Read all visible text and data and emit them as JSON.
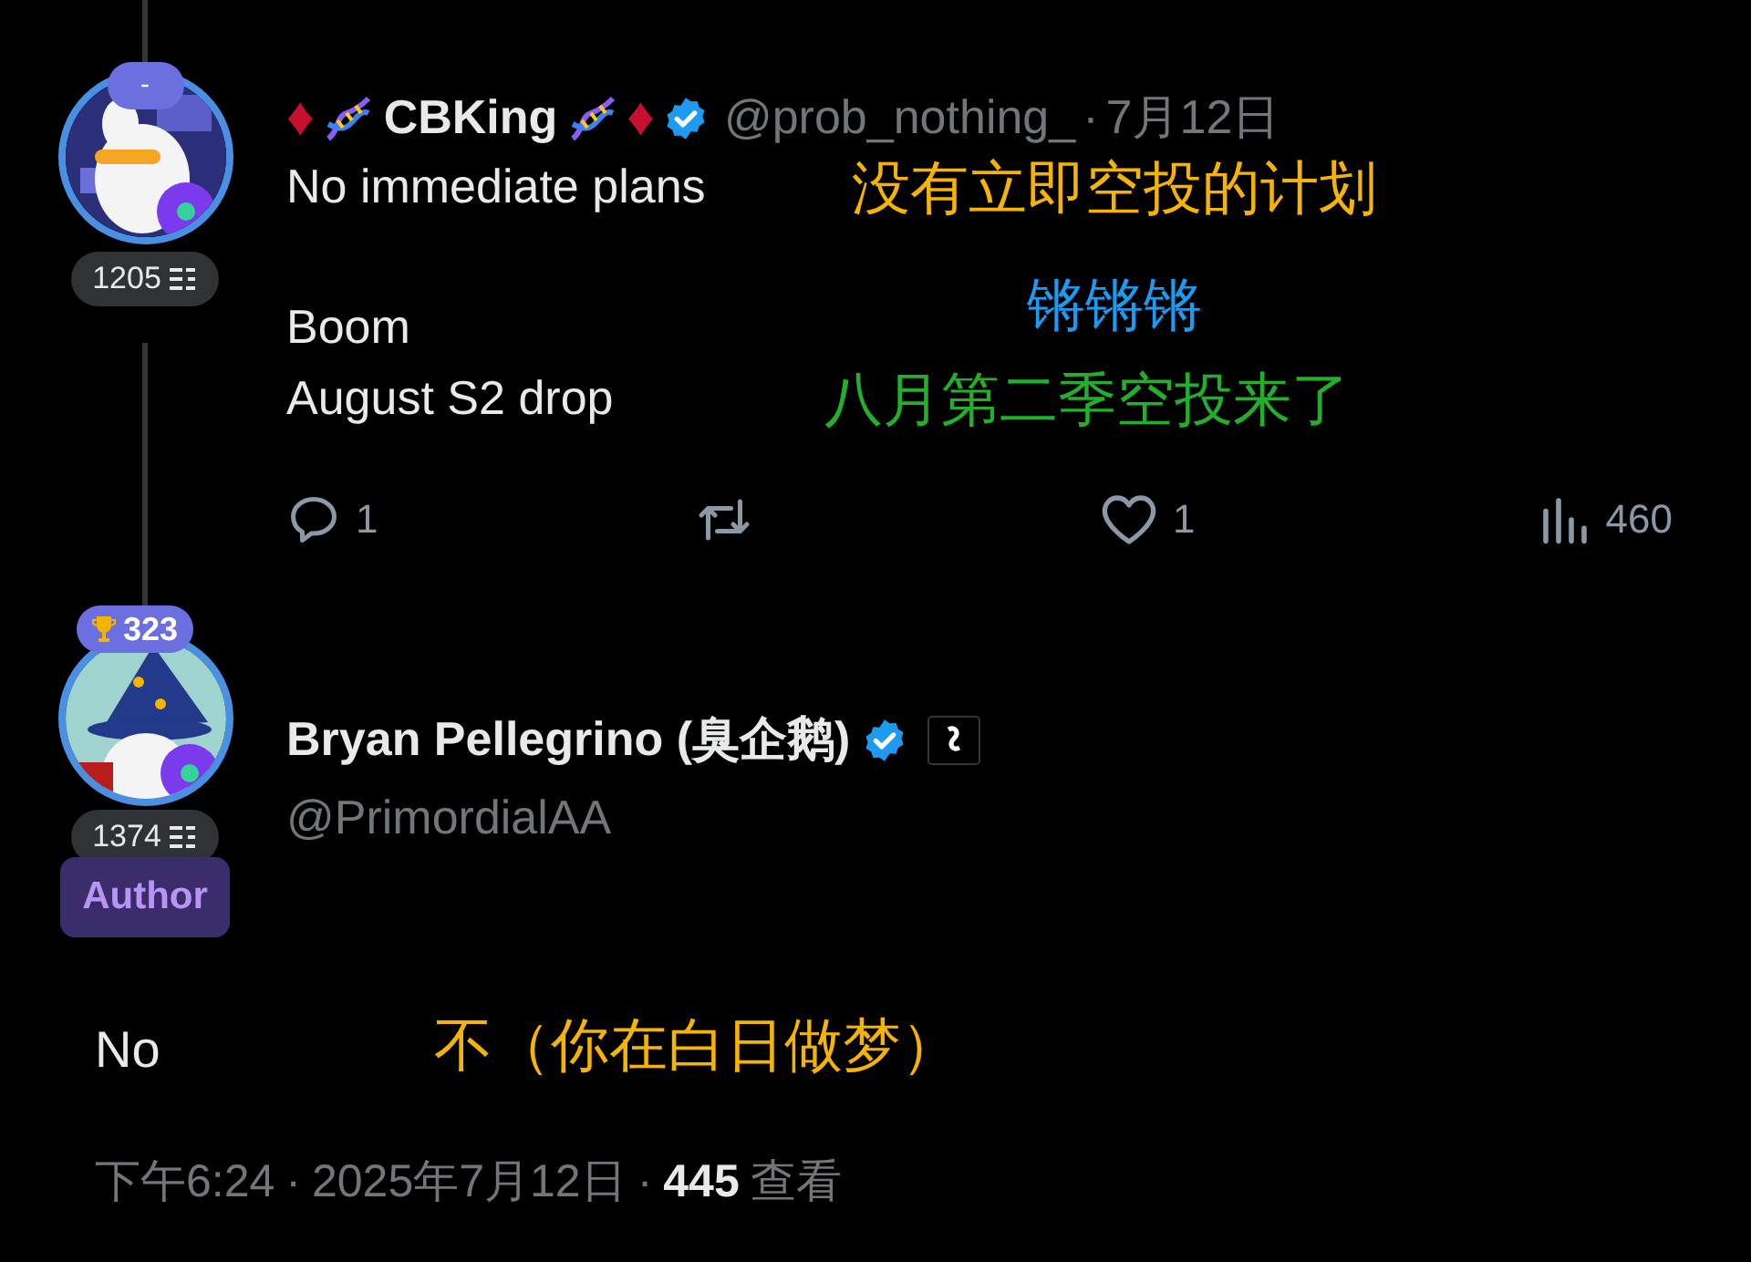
{
  "tweet": {
    "avatar": {
      "kind": "picture",
      "badge": "-",
      "score": "1205"
    },
    "name_left": "♦",
    "name": "CBKing",
    "name_right": "♦",
    "verified": true,
    "handle": "@prob_nothing_",
    "separator": "·",
    "date": "7月12日",
    "lines": [
      {
        "text": "No immediate plans",
        "note": "没有立即空投的计划",
        "color": "#f5b400"
      },
      {
        "text": "Boom",
        "note": "锵锵锵",
        "color": "#1d9bf0"
      },
      {
        "text": "August S2 drop",
        "note": "八月第二季空投来了",
        "color": "#22b02a"
      }
    ],
    "actions": [
      {
        "kind": "reply",
        "count": "1"
      },
      {
        "kind": "repost"
      },
      {
        "kind": "like",
        "count": "1"
      },
      {
        "kind": "views",
        "count": "460"
      }
    ]
  },
  "reply": {
    "avatar": {
      "kind": "picture",
      "trophy_score": "323",
      "score": "1374"
    },
    "author_badge": "Author",
    "name": "Bryan Pellegrino (臭企鹅)",
    "verified": true,
    "affiliate": true,
    "handle": "@PrimordialAA",
    "text": "No",
    "note": {
      "text": "不（你在白日做梦）",
      "color": "#f5b400"
    },
    "meta": {
      "time": "下午6:24",
      "separator": "·",
      "date": "2025年7月12日",
      "views": "445",
      "views_label": "查看"
    }
  }
}
